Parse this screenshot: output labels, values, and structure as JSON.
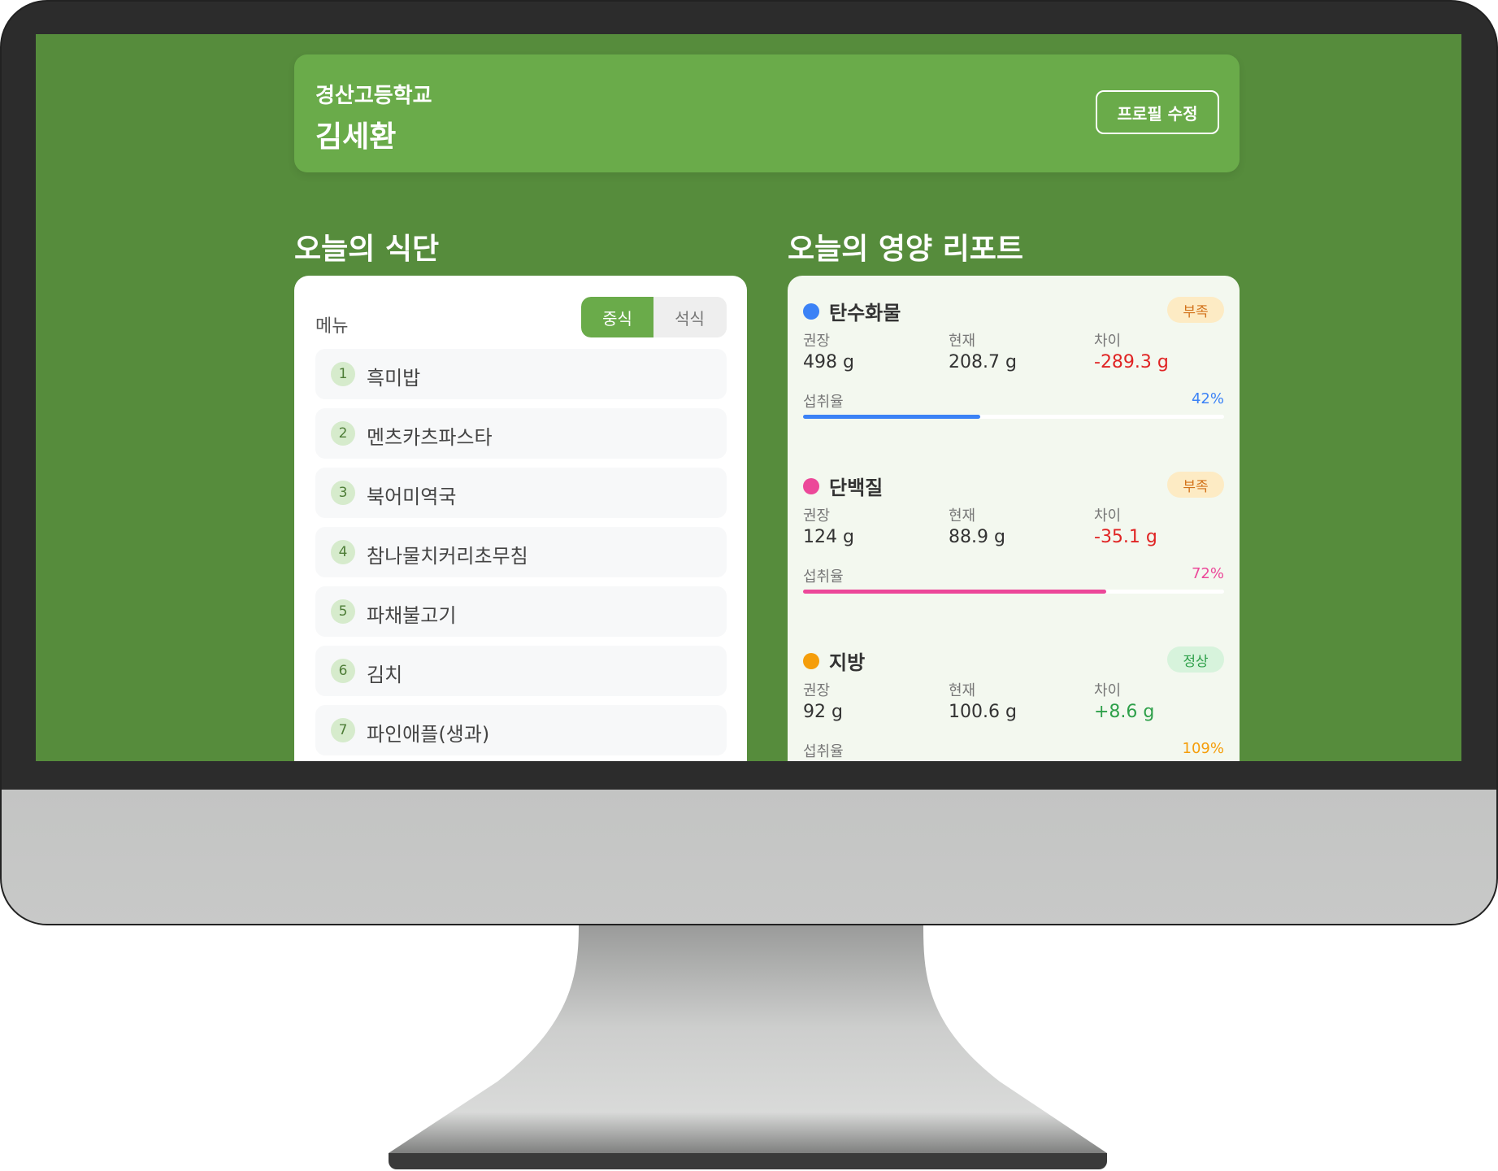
{
  "profile": {
    "school": "경산고등학교",
    "name": "김세환",
    "edit_label": "프로필 수정"
  },
  "menu_section": {
    "title": "오늘의 식단",
    "menu_label": "메뉴",
    "toggle": {
      "lunch": "중식",
      "dinner": "석식",
      "selected": "중식"
    },
    "items": [
      {
        "num": "1",
        "name": "흑미밥"
      },
      {
        "num": "2",
        "name": "멘츠카츠파스타"
      },
      {
        "num": "3",
        "name": "북어미역국"
      },
      {
        "num": "4",
        "name": "참나물치커리초무침"
      },
      {
        "num": "5",
        "name": "파채불고기"
      },
      {
        "num": "6",
        "name": "김치"
      },
      {
        "num": "7",
        "name": "파인애플(생과)"
      }
    ]
  },
  "nutrition_section": {
    "title": "오늘의 영양 리포트",
    "col_recommended": "권장",
    "col_current": "현재",
    "col_diff": "차이",
    "intake_label": "섭취율",
    "nutrients": [
      {
        "name": "탄수화물",
        "status": "부족",
        "recommended": "498 g",
        "current": "208.7 g",
        "diff": "-289.3 g",
        "intake": "42%",
        "intake_value": 42,
        "color": "#3b82f6"
      },
      {
        "name": "단백질",
        "status": "부족",
        "recommended": "124 g",
        "current": "88.9 g",
        "diff": "-35.1 g",
        "intake": "72%",
        "intake_value": 72,
        "color": "#ec4899"
      },
      {
        "name": "지방",
        "status": "정상",
        "recommended": "92 g",
        "current": "100.6 g",
        "diff": "+8.6 g",
        "intake": "109%",
        "intake_value": 109,
        "color": "#f59e0b"
      }
    ]
  },
  "colors": {
    "background": "#568c3c",
    "accent": "#6aab4a"
  }
}
